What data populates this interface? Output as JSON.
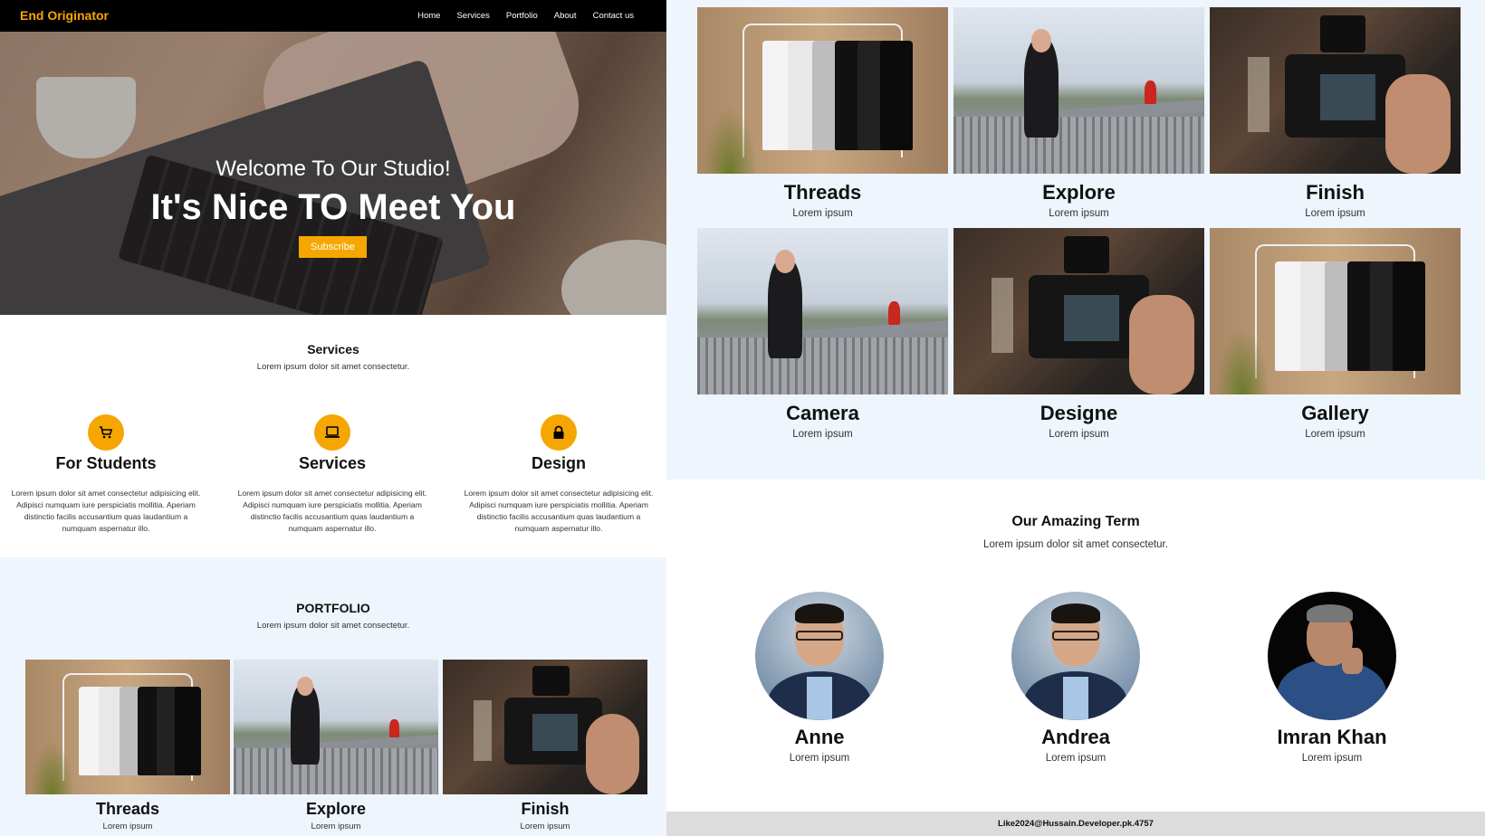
{
  "brand": {
    "name": "End Originator",
    "accent": "#f6a600"
  },
  "nav": {
    "items": [
      "Home",
      "Services",
      "Portfolio",
      "About",
      "Contact us"
    ]
  },
  "hero": {
    "subtitle": "Welcome To Our Studio!",
    "title": "It's Nice TO Meet You",
    "button": "Subscribe"
  },
  "services": {
    "title": "Services",
    "subtitle": "Lorem ipsum dolor sit amet consectetur.",
    "items": [
      {
        "icon": "cart-icon",
        "title": "For Students",
        "text": "Lorem ipsum dolor sit amet consectetur adipisicing elit. Adipisci numquam iure perspiciatis mollitia. Aperiam distinctio facilis accusantium quas laudantium a numquam aspernatur illo."
      },
      {
        "icon": "laptop-icon",
        "title": "Services",
        "text": "Lorem ipsum dolor sit amet consectetur adipisicing elit. Adipisci numquam iure perspiciatis mollitia. Aperiam distinctio facilis accusantium quas laudantium a numquam aspernatur illo."
      },
      {
        "icon": "lock-icon",
        "title": "Design",
        "text": "Lorem ipsum dolor sit amet consectetur adipisicing elit. Adipisci numquam iure perspiciatis mollitia. Aperiam distinctio facilis accusantium quas laudantium a numquam aspernatur illo."
      }
    ]
  },
  "portfolio": {
    "title": "PORTFOLIO",
    "subtitle": "Lorem ipsum dolor sit amet consectetur.",
    "items": [
      {
        "name": "Threads",
        "desc": "Lorem ipsum"
      },
      {
        "name": "Explore",
        "desc": "Lorem ipsum"
      },
      {
        "name": "Finish",
        "desc": "Lorem ipsum"
      }
    ]
  },
  "gallery": {
    "items": [
      {
        "name": "Threads",
        "desc": "Lorem ipsum"
      },
      {
        "name": "Explore",
        "desc": "Lorem ipsum"
      },
      {
        "name": "Finish",
        "desc": "Lorem ipsum"
      },
      {
        "name": "Camera",
        "desc": "Lorem ipsum"
      },
      {
        "name": "Designe",
        "desc": "Lorem ipsum"
      },
      {
        "name": "Gallery",
        "desc": "Lorem ipsum"
      }
    ]
  },
  "team": {
    "title": "Our Amazing Term",
    "subtitle": "Lorem ipsum dolor sit amet consectetur.",
    "members": [
      {
        "name": "Anne",
        "desc": "Lorem ipsum"
      },
      {
        "name": "Andrea",
        "desc": "Lorem ipsum"
      },
      {
        "name": "Imran Khan",
        "desc": "Lorem ipsum"
      }
    ]
  },
  "footer": {
    "text": "Like2024@Hussain.Developer.pk.4757"
  }
}
